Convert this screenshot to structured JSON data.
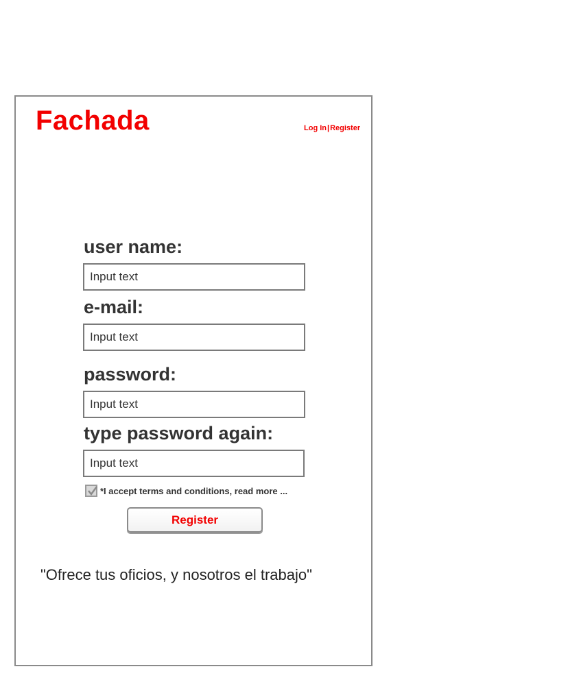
{
  "brand": {
    "name": "Fachada",
    "color": "#f20000"
  },
  "header": {
    "login_label": "Log In",
    "separator": "|",
    "register_label": "Register"
  },
  "form": {
    "username": {
      "label": "user name:",
      "placeholder": "Input text"
    },
    "email": {
      "label": "e-mail:",
      "placeholder": "Input text"
    },
    "password": {
      "label": "password:",
      "placeholder": "Input text"
    },
    "password_again": {
      "label": "type password again:",
      "placeholder": "Input text"
    },
    "terms": {
      "text": "*I accept terms and conditions, read more ...",
      "checked": true
    },
    "submit_label": "Register"
  },
  "slogan": "\"Ofrece tus oficios, y nosotros el trabajo\"",
  "icons": {
    "checkbox": "check-icon"
  }
}
